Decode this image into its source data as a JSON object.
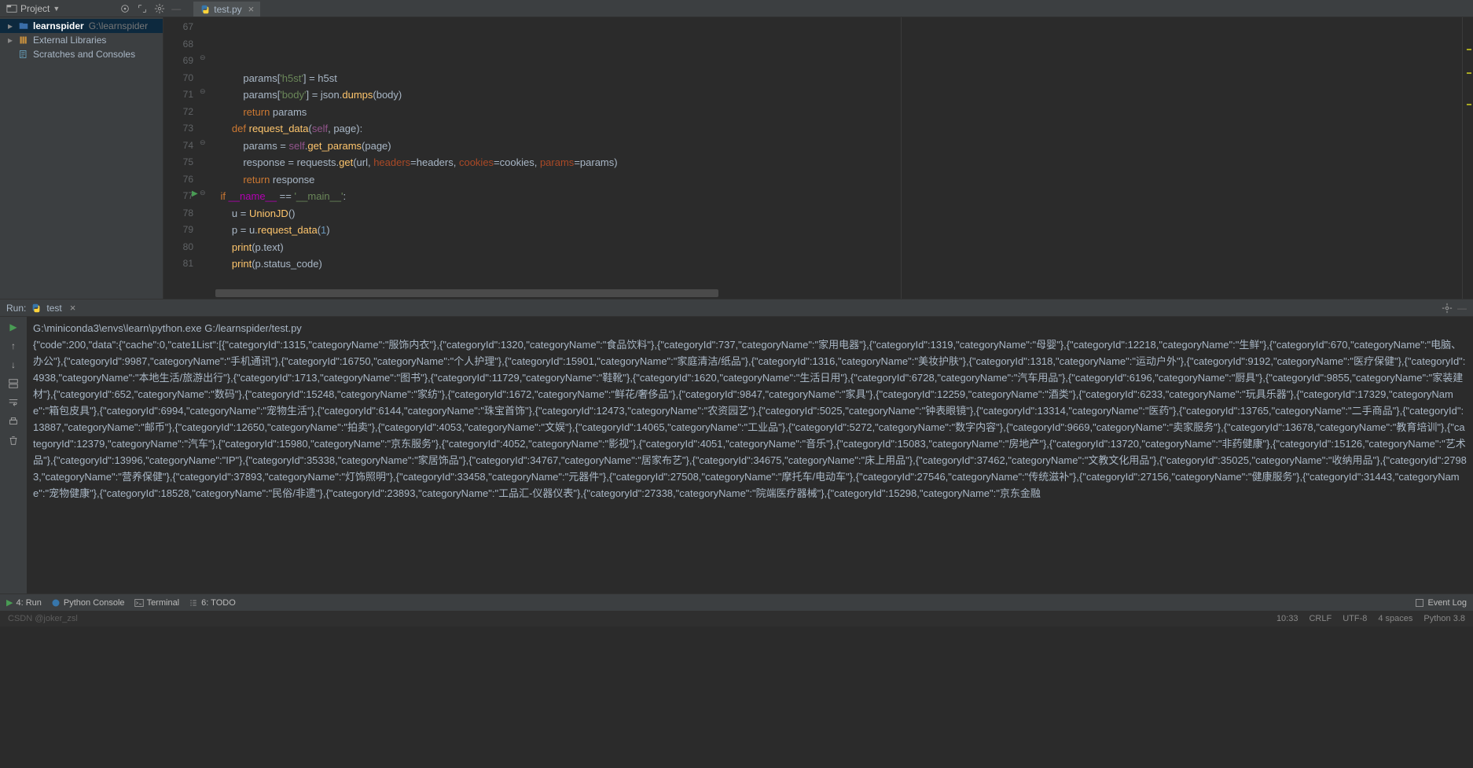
{
  "toolbar": {
    "project_label": "Project",
    "tab_file": "test.py"
  },
  "tree": {
    "root": "learnspider",
    "root_path": "G:\\learnspider",
    "ext_lib": "External Libraries",
    "scratches": "Scratches and Consoles"
  },
  "gutter_lines": [
    "67",
    "68",
    "69",
    "70",
    "71",
    "72",
    "73",
    "74",
    "75",
    "76",
    "77",
    "78",
    "79",
    "80",
    "81"
  ],
  "code_lines": [
    "            params['h5st'] = h5st",
    "            params['body'] = json.dumps(body)",
    "            return params",
    "",
    "        def request_data(self, page):",
    "            params = self.get_params(page)",
    "            response = requests.get(url, headers=headers, cookies=cookies, params=params)",
    "            return response",
    "",
    "",
    "    if __name__ == '__main__':",
    "        u = UnionJD()",
    "        p = u.request_data(1)",
    "        print(p.text)",
    "        print(p.status_code)"
  ],
  "run": {
    "label": "Run:",
    "config": "test",
    "cmd": "G:\\miniconda3\\envs\\learn\\python.exe G:/learnspider/test.py",
    "output": "{\"code\":200,\"data\":{\"cache\":0,\"cate1List\":[{\"categoryId\":1315,\"categoryName\":\"服饰内衣\"},{\"categoryId\":1320,\"categoryName\":\"食品饮料\"},{\"categoryId\":737,\"categoryName\":\"家用电器\"},{\"categoryId\":1319,\"categoryName\":\"母婴\"},{\"categoryId\":12218,\"categoryName\":\"生鲜\"},{\"categoryId\":670,\"categoryName\":\"电脑、办公\"},{\"categoryId\":9987,\"categoryName\":\"手机通讯\"},{\"categoryId\":16750,\"categoryName\":\"个人护理\"},{\"categoryId\":15901,\"categoryName\":\"家庭清洁/纸品\"},{\"categoryId\":1316,\"categoryName\":\"美妆护肤\"},{\"categoryId\":1318,\"categoryName\":\"运动户外\"},{\"categoryId\":9192,\"categoryName\":\"医疗保健\"},{\"categoryId\":4938,\"categoryName\":\"本地生活/旅游出行\"},{\"categoryId\":1713,\"categoryName\":\"图书\"},{\"categoryId\":11729,\"categoryName\":\"鞋靴\"},{\"categoryId\":1620,\"categoryName\":\"生活日用\"},{\"categoryId\":6728,\"categoryName\":\"汽车用品\"},{\"categoryId\":6196,\"categoryName\":\"厨具\"},{\"categoryId\":9855,\"categoryName\":\"家装建材\"},{\"categoryId\":652,\"categoryName\":\"数码\"},{\"categoryId\":15248,\"categoryName\":\"家纺\"},{\"categoryId\":1672,\"categoryName\":\"鲜花/奢侈品\"},{\"categoryId\":9847,\"categoryName\":\"家具\"},{\"categoryId\":12259,\"categoryName\":\"酒类\"},{\"categoryId\":6233,\"categoryName\":\"玩具乐器\"},{\"categoryId\":17329,\"categoryName\":\"箱包皮具\"},{\"categoryId\":6994,\"categoryName\":\"宠物生活\"},{\"categoryId\":6144,\"categoryName\":\"珠宝首饰\"},{\"categoryId\":12473,\"categoryName\":\"农资园艺\"},{\"categoryId\":5025,\"categoryName\":\"钟表眼镜\"},{\"categoryId\":13314,\"categoryName\":\"医药\"},{\"categoryId\":13765,\"categoryName\":\"二手商品\"},{\"categoryId\":13887,\"categoryName\":\"邮币\"},{\"categoryId\":12650,\"categoryName\":\"拍卖\"},{\"categoryId\":4053,\"categoryName\":\"文娱\"},{\"categoryId\":14065,\"categoryName\":\"工业品\"},{\"categoryId\":5272,\"categoryName\":\"数字内容\"},{\"categoryId\":9669,\"categoryName\":\"卖家服务\"},{\"categoryId\":13678,\"categoryName\":\"教育培训\"},{\"categoryId\":12379,\"categoryName\":\"汽车\"},{\"categoryId\":15980,\"categoryName\":\"京东服务\"},{\"categoryId\":4052,\"categoryName\":\"影视\"},{\"categoryId\":4051,\"categoryName\":\"音乐\"},{\"categoryId\":15083,\"categoryName\":\"房地产\"},{\"categoryId\":13720,\"categoryName\":\"非药健康\"},{\"categoryId\":15126,\"categoryName\":\"艺术品\"},{\"categoryId\":13996,\"categoryName\":\"IP\"},{\"categoryId\":35338,\"categoryName\":\"家居饰品\"},{\"categoryId\":34767,\"categoryName\":\"居家布艺\"},{\"categoryId\":34675,\"categoryName\":\"床上用品\"},{\"categoryId\":37462,\"categoryName\":\"文教文化用品\"},{\"categoryId\":35025,\"categoryName\":\"收纳用品\"},{\"categoryId\":27983,\"categoryName\":\"营养保健\"},{\"categoryId\":37893,\"categoryName\":\"灯饰照明\"},{\"categoryId\":33458,\"categoryName\":\"元器件\"},{\"categoryId\":27508,\"categoryName\":\"摩托车/电动车\"},{\"categoryId\":27546,\"categoryName\":\"传统滋补\"},{\"categoryId\":27156,\"categoryName\":\"健康服务\"},{\"categoryId\":31443,\"categoryName\":\"宠物健康\"},{\"categoryId\":18528,\"categoryName\":\"民俗/非遗\"},{\"categoryId\":23893,\"categoryName\":\"工品汇-仪器仪表\"},{\"categoryId\":27338,\"categoryName\":\"院端医疗器械\"},{\"categoryId\":15298,\"categoryName\":\"京东金融"
  },
  "bottom": {
    "run": "4: Run",
    "python_console": "Python Console",
    "terminal": "Terminal",
    "todo": "6: TODO",
    "event_log": "Event Log"
  },
  "status": {
    "pos": "10:33",
    "line_sep": "CRLF",
    "encoding": "UTF-8",
    "indent": "4 spaces",
    "interpreter": "Python 3.8",
    "watermark": "CSDN @joker_zsl"
  }
}
